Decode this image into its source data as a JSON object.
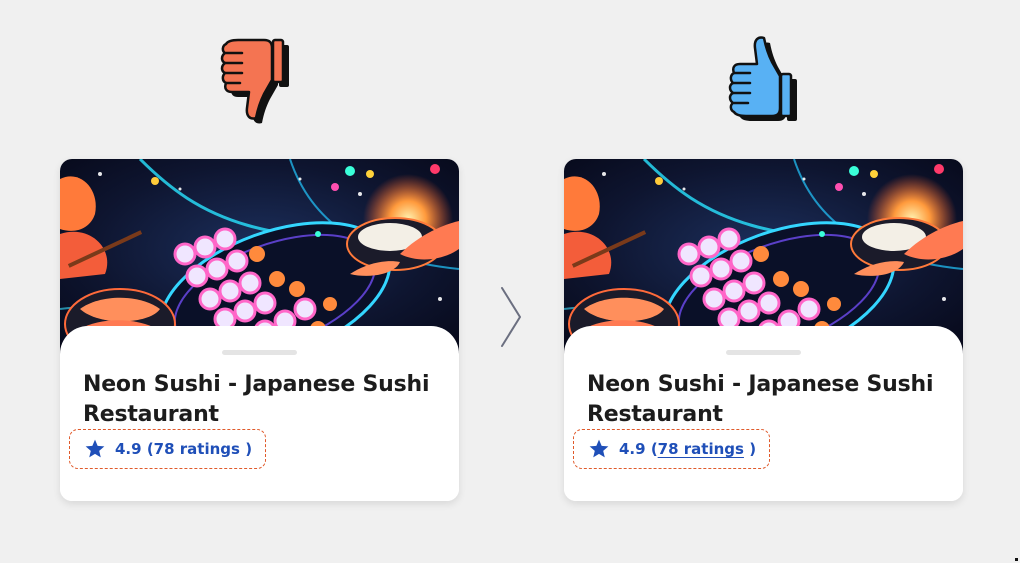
{
  "colors": {
    "background": "#f0f0f0",
    "thumbs_down": "#f47452",
    "thumbs_up": "#58b1f4",
    "rating_text": "#1f4fb8",
    "highlight_border": "#e05a2b"
  },
  "comparison": {
    "bad_icon": "thumbs-down-icon",
    "good_icon": "thumbs-up-icon",
    "divider_icon": "chevron-right-icon"
  },
  "cards": [
    {
      "variant": "bad",
      "image": "sushi-neon-photo",
      "title": "Neon Sushi -  Japanese Sushi Restaurant",
      "rating_value": "4.9",
      "rating_open": "(",
      "rating_link": "78 ratings",
      "rating_close": ")",
      "rating_underlined": false
    },
    {
      "variant": "good",
      "image": "sushi-neon-photo",
      "title": "Neon Sushi -  Japanese Sushi Restaurant",
      "rating_value": "4.9",
      "rating_open": "(",
      "rating_link": "78 ratings",
      "rating_close": ")",
      "rating_underlined": true
    }
  ]
}
